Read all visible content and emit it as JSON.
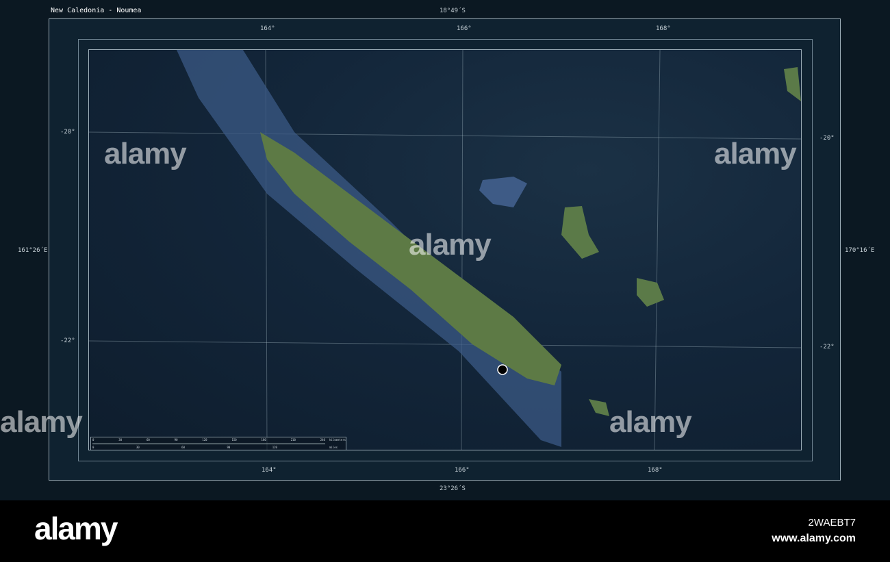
{
  "title": "New Caledonia - Noumea",
  "frame": {
    "top": "18°49´S",
    "bottom": "23°26´S",
    "left": "161°26´E",
    "right": "170°16´E"
  },
  "lon_labels": [
    "164°",
    "166°",
    "168°"
  ],
  "lat_labels": [
    "-20°",
    "-22°"
  ],
  "scale": {
    "km_ticks": [
      "0",
      "30",
      "60",
      "90",
      "120",
      "150",
      "180",
      "210",
      "240"
    ],
    "km_unit": "kilometers",
    "mi_ticks": [
      "0",
      "30",
      "60",
      "90",
      "120"
    ],
    "mi_unit": "miles"
  },
  "watermark": "alamy",
  "footer": {
    "logo": "alamy",
    "image_id": "2WAEBT7",
    "url": "www.alamy.com"
  },
  "colors": {
    "ocean": "#13263a",
    "land": "#5d7a45",
    "shelf": "#3a5f7e"
  }
}
